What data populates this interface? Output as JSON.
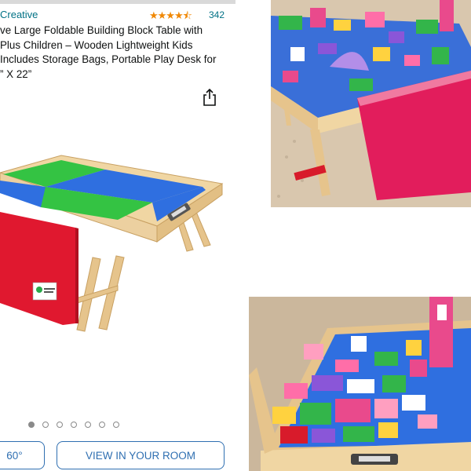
{
  "header": {
    "brand": "Creative",
    "stars": "★★★★⯪",
    "rating_count": "342",
    "title_lines": [
      "ve Large Foldable Building Block Table with",
      "Plus Children – Wooden Lightweight Kids",
      " Includes Storage Bags, Portable Play Desk for",
      "” X 22”"
    ]
  },
  "icons": {
    "share": "share-icon"
  },
  "carousel": {
    "dot_count": 7,
    "active_index": 0
  },
  "buttons": {
    "view_360": "60°",
    "view_in_room": "VIEW IN YOUR ROOM"
  },
  "colors": {
    "link": "#007185",
    "star": "#f08804",
    "button_border": "#2f6fb1",
    "table_green": "#34c343",
    "table_blue": "#2f6fe0",
    "bag_red": "#e0182f",
    "wood": "#e9c894"
  }
}
